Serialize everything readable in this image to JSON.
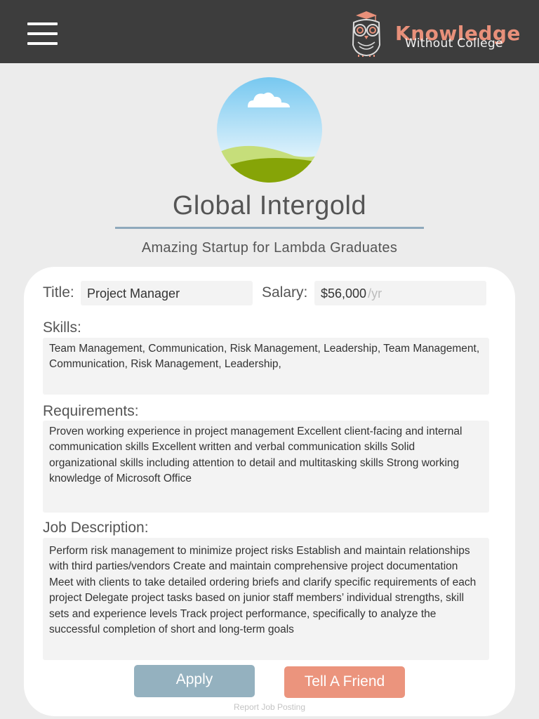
{
  "header": {
    "brand_word": "Knowledge",
    "brand_sub": "Without College",
    "menu_icon": "hamburger-menu-icon",
    "logo_icon": "owl-graduate-icon",
    "colors": {
      "bar": "#3d3d3d",
      "brand": "#e8907a"
    }
  },
  "company": {
    "name": "Global Intergold",
    "tagline": "Amazing Startup for Lambda Graduates",
    "image_icon": "landscape-placeholder-icon"
  },
  "job": {
    "title_label": "Title:",
    "title_value": "Project Manager",
    "salary_label": "Salary:",
    "salary_value": "$56,000",
    "salary_unit": "/yr",
    "skills_label": "Skills:",
    "skills_value": "Team Management, Communication, Risk Management, Leadership, Team Management, Communication, Risk Management, Leadership,",
    "requirements_label": "Requirements:",
    "requirements_value": "Proven working experience in project management Excellent client-facing and internal communication skills Excellent written and verbal communication skills Solid organizational skills including attention to detail and multitasking skills Strong working knowledge of Microsoft Office",
    "description_label": "Job Description:",
    "description_value": "Perform risk management to minimize project risks Establish and maintain relationships with third parties/vendors Create and maintain comprehensive project documentation Meet with clients to take detailed ordering briefs and clarify specific requirements of each project Delegate project tasks based on junior staff members’ individual strengths, skill sets and experience levels Track project performance, specifically to analyze the successful completion of short and long-term goals"
  },
  "actions": {
    "apply_label": "Apply",
    "tell_label": "Tell A Friend",
    "report_label": "Report Job Posting",
    "colors": {
      "apply": "#94b1bf",
      "tell": "#eb947d"
    }
  }
}
